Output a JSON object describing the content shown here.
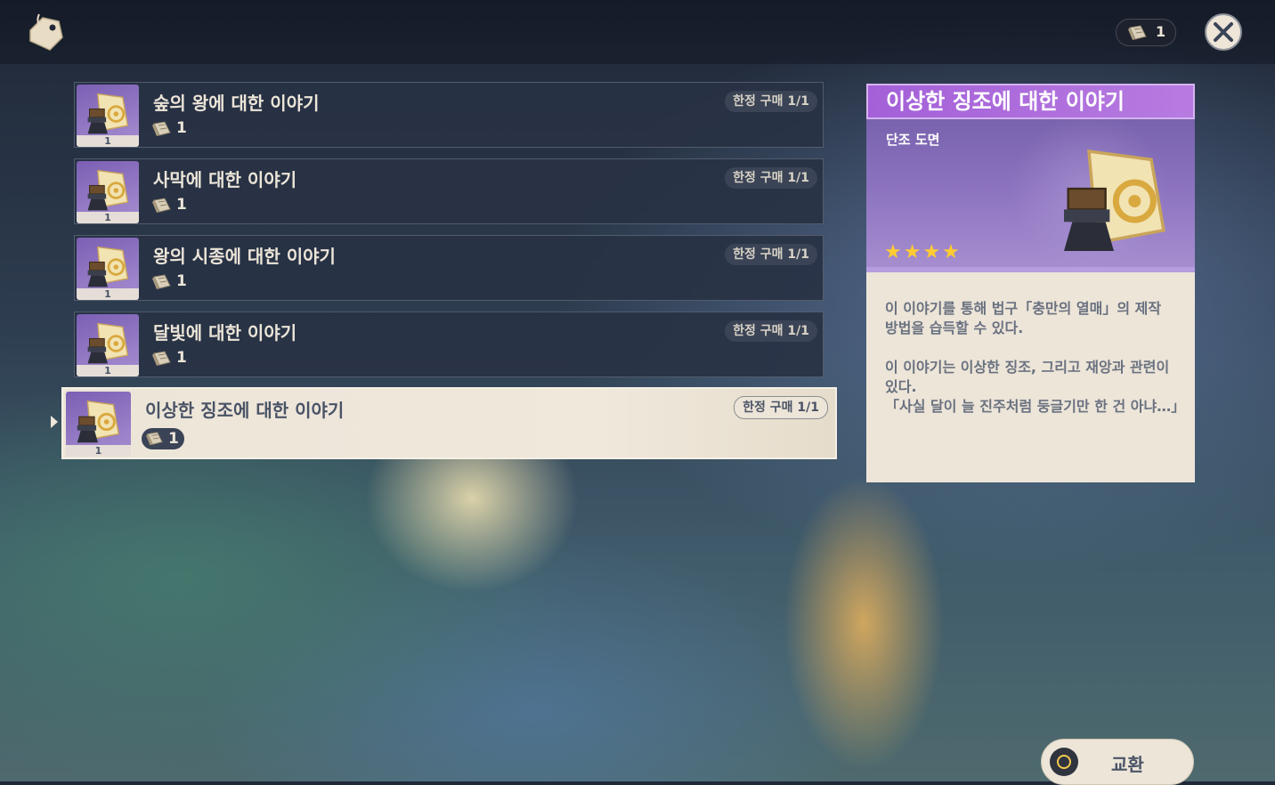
{
  "header": {
    "shop_icon": "price-tag-icon",
    "currency": {
      "icon": "scroll-icon",
      "amount": "1"
    },
    "close_icon": "close-icon"
  },
  "items": [
    {
      "name": "숲의 왕에 대한 이야기",
      "limit": "한정 구매 1/1",
      "price": "1",
      "count": "1",
      "selected": false
    },
    {
      "name": "사막에 대한 이야기",
      "limit": "한정 구매 1/1",
      "price": "1",
      "count": "1",
      "selected": false
    },
    {
      "name": "왕의 시종에 대한 이야기",
      "limit": "한정 구매 1/1",
      "price": "1",
      "count": "1",
      "selected": false
    },
    {
      "name": "달빛에 대한 이야기",
      "limit": "한정 구매 1/1",
      "price": "1",
      "count": "1",
      "selected": false
    },
    {
      "name": "이상한 징조에 대한 이야기",
      "limit": "한정 구매 1/1",
      "price": "1",
      "count": "1",
      "selected": true
    }
  ],
  "detail": {
    "name": "이상한 징조에 대한 이야기",
    "type": "단조 도면",
    "rarity": 4,
    "stars": "★★★★",
    "description_1": "이 이야기를 통해 법구「충만의 열매」의 제작 방법을 습득할 수 있다.",
    "description_2": "이 이야기는 이상한 징조, 그리고 재앙과 관련이 있다.",
    "description_3": "「사실 달이 늘 진주처럼 둥글기만 한 건 아냐…」"
  },
  "actions": {
    "exchange_label": "교환"
  },
  "colors": {
    "accent_purple": "#a460d8",
    "card_bg": "#ece5d8",
    "star": "#ffcc33"
  }
}
